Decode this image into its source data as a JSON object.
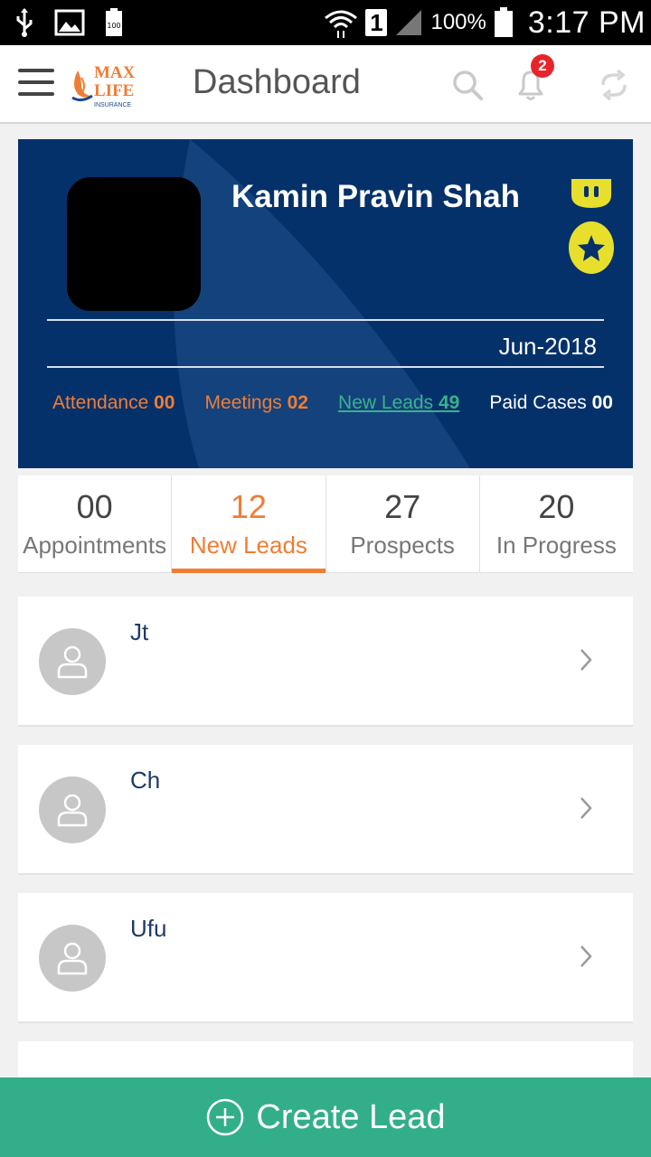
{
  "status_bar": {
    "battery_percent": "100%",
    "time": "3:17 PM",
    "sim_slot": "1",
    "icons": [
      "usb-icon",
      "image-icon",
      "battery-100-icon",
      "wifi-icon",
      "signal-icon",
      "battery-icon"
    ]
  },
  "app_bar": {
    "title": "Dashboard",
    "logo_text_1": "MAX",
    "logo_text_2": "LIFE",
    "logo_text_3": "INSURANCE",
    "notification_count": "2"
  },
  "profile": {
    "name": "Kamin Pravin Shah",
    "period": "Jun-2018",
    "stats": [
      {
        "label": "Attendance",
        "value": "00"
      },
      {
        "label": "Meetings",
        "value": "02"
      },
      {
        "label": "New Leads",
        "value": "49"
      },
      {
        "label": "Paid Cases",
        "value": "00"
      }
    ]
  },
  "tabs": [
    {
      "count": "00",
      "label": "Appointments"
    },
    {
      "count": "12",
      "label": "New Leads"
    },
    {
      "count": "27",
      "label": "Prospects"
    },
    {
      "count": "20",
      "label": "In Progress"
    }
  ],
  "leads": [
    {
      "name": "Jt"
    },
    {
      "name": "Ch"
    },
    {
      "name": "Ufu"
    }
  ],
  "create_button": {
    "label": "Create Lead"
  },
  "colors": {
    "primary_navy": "#05316b",
    "accent_orange": "#f07d34",
    "accent_green": "#33ae8b",
    "badge_red": "#e8242b",
    "medal_yellow": "#e8df2c"
  }
}
